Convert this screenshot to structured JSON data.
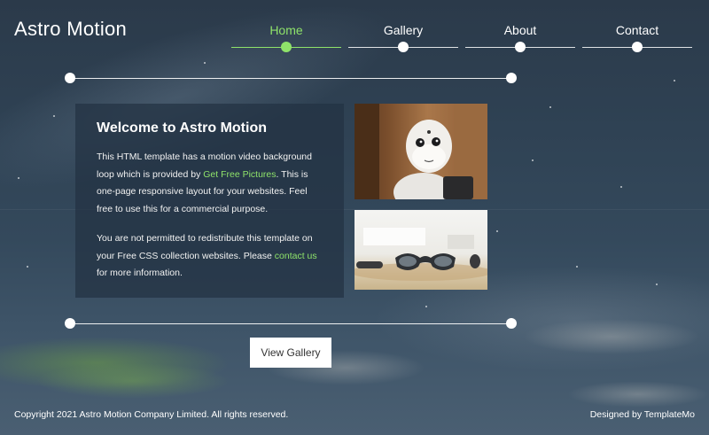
{
  "brand": {
    "name": "Astro Motion"
  },
  "nav": {
    "items": [
      {
        "label": "Home",
        "active": true
      },
      {
        "label": "Gallery",
        "active": false
      },
      {
        "label": "About",
        "active": false
      },
      {
        "label": "Contact",
        "active": false
      }
    ]
  },
  "welcome": {
    "title": "Welcome to Astro Motion",
    "p1_before": "This HTML template has a motion video background loop which is provided by ",
    "p1_link": "Get Free Pictures",
    "p1_after": ". This is one-page responsive layout for your websites. Feel free to use this for a commercial purpose.",
    "p2_before": "You are not permitted to redistribute this template on your Free CSS collection websites. Please ",
    "p2_link": "contact us",
    "p2_after": " for more information."
  },
  "gallery": {
    "button_label": "View Gallery"
  },
  "footer": {
    "copyright": "Copyright 2021 Astro Motion Company Limited. All rights reserved.",
    "credit": "Designed by TemplateMo"
  },
  "colors": {
    "accent": "#8fe36a",
    "panel": "#233242"
  },
  "icons": {
    "robot_photo": "robot-photo",
    "glasses_photo": "smart-glasses-photo"
  }
}
